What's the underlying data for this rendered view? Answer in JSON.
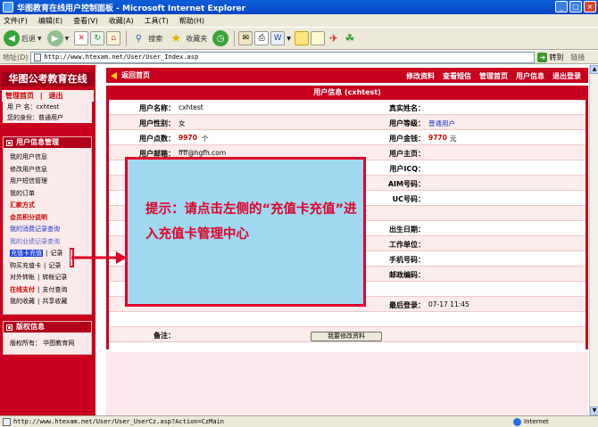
{
  "window": {
    "title": "华图教育在线用户控制面板 - Microsoft Internet Explorer",
    "buttons": {
      "minimize": "_",
      "maximize": "□",
      "close": "×"
    }
  },
  "menu": [
    "文件(F)",
    "编辑(E)",
    "查看(V)",
    "收藏(A)",
    "工具(T)",
    "帮助(H)"
  ],
  "toolbar": {
    "back": "后退",
    "search": "搜索",
    "favorites": "收藏夹"
  },
  "address": {
    "label": "地址(D)",
    "url": "http://www.htexam.net/User/User_Index.asp",
    "go": "转到",
    "links": "链接"
  },
  "sidebar": {
    "brand": "华图公考教育在线",
    "top_links": {
      "admin": "管理首页",
      "sep": "|",
      "logout": "退出"
    },
    "username_label": "用 户 名：cxhtest",
    "identity_label": "您的身份：普通用户",
    "section_user": "用户信息管理",
    "items": [
      {
        "label": "我的用户信息",
        "style": ""
      },
      {
        "label": "修改用户信息",
        "style": ""
      },
      {
        "label": "用户短信管理",
        "style": ""
      },
      {
        "label": "我的订单",
        "style": ""
      },
      {
        "label": "汇款方式",
        "style": "red"
      },
      {
        "label": "会员积分说明",
        "style": "red"
      },
      {
        "label": "我的消费记录查询",
        "style": "blue"
      },
      {
        "label": "我的业绩记录查询",
        "style": "light"
      }
    ],
    "pair_items": [
      {
        "main": "充值卡充值",
        "sub": "记录",
        "style": "highlight"
      },
      {
        "main": "购买充值卡",
        "sub": "记录",
        "style": ""
      },
      {
        "main": "对外转帐",
        "sub": "转帐记录",
        "style": ""
      },
      {
        "main": "在线支付",
        "sub": "支付查询",
        "style": "red"
      },
      {
        "main": "我的收藏",
        "sub": "共享收藏",
        "style": ""
      }
    ],
    "section_copyright": "版权信息",
    "copyright": "版权所有： 华图教育网"
  },
  "mainbar": {
    "back": "返回首页",
    "links": [
      "修改资料",
      "查看短信",
      "管理首页",
      "用户信息",
      "退出登录"
    ]
  },
  "panel": {
    "title": "用户信息 (cxhtest)",
    "rows": [
      {
        "l1": "用户名称：",
        "v1": "cxhtest",
        "l2": "真实姓名：",
        "v2": ""
      },
      {
        "l1": "用户性别：",
        "v1": "女",
        "l2": "用户等级：",
        "v2": "普通用户"
      },
      {
        "l1": "用户点数：",
        "v1": "9970",
        "v1b": "个",
        "l2": "用户金钱：",
        "v2": "9770",
        "v2b": "元"
      },
      {
        "l1": "用户邮箱：",
        "v1": "ffff@hgfh.com",
        "l2": "用户主页：",
        "v2": ""
      },
      {
        "l1": "",
        "v1": "",
        "l2": "用户ICQ：",
        "v2": ""
      },
      {
        "l1": "",
        "v1": "",
        "l2": "AIM号码：",
        "v2": ""
      },
      {
        "l1": "",
        "v1": "",
        "l2": "UC号码：",
        "v2": ""
      },
      {
        "l1": "",
        "v1": "",
        "l2": "",
        "v2": ""
      },
      {
        "l1": "",
        "v1": "",
        "l2": "出生日期：",
        "v2": ""
      },
      {
        "l1": "",
        "v1": "",
        "l2": "工作单位：",
        "v2": ""
      },
      {
        "l1": "",
        "v1": "",
        "l2": "手机号码：",
        "v2": ""
      },
      {
        "l1": "",
        "v1": "",
        "l2": "邮政编码：",
        "v2": ""
      },
      {
        "l1": "",
        "v1": "",
        "l2": "",
        "v2": ""
      },
      {
        "l1": "",
        "v1": "",
        "l2": "最后登录：",
        "v2": "07-17 11:45"
      },
      {
        "l1": "",
        "v1": "",
        "l2": "",
        "v2": ""
      },
      {
        "l1": "备注：",
        "v1": "",
        "l2": "",
        "v2": ""
      }
    ],
    "edit_button": "我要修改资料"
  },
  "callout": {
    "text": "提示：请点击左侧的“充值卡充值”进入充值卡管理中心"
  },
  "status": {
    "url": "http://www.htexam.net/User/User_UserCz.asp?Action=CzMain",
    "zone": "Internet"
  },
  "colors": {
    "theme_red": "#c8001e",
    "callout_bg": "#9fd8f0",
    "callout_border": "#e0002a"
  }
}
